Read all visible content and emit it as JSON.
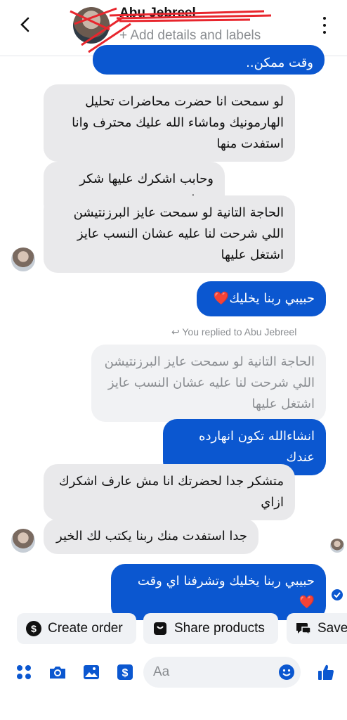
{
  "header": {
    "name": "Abu Jebreel",
    "subtitle": "+ Add details and labels"
  },
  "chat": {
    "top_partial": "وقت ممكن..",
    "messages": [
      {
        "who": "in",
        "text": "لو سمحت انا حضرت محاضرات تحليل الهارمونيك وماشاء الله عليك محترف وانا استفدت منها"
      },
      {
        "who": "in",
        "text": "وحابب اشكرك عليها شكر جزيل"
      },
      {
        "who": "in",
        "text": "الحاجة التانية لو سمحت عايز البرزنتيشن اللي شرحت لنا عليه عشان النسب عايز اشتغل عليها"
      },
      {
        "who": "out",
        "text": "حبيبي ربنا يخليك❤️"
      },
      {
        "who": "meta",
        "text": "You replied to Abu Jebreel"
      },
      {
        "who": "quoted",
        "text": "الحاجة التانية لو سمحت عايز البرزنتيشن اللي شرحت لنا عليه عشان النسب عايز اشتغل عليها"
      },
      {
        "who": "out",
        "text": "انشاءالله تكون انهارده عندك"
      },
      {
        "who": "in",
        "text": "متشكر جدا لحضرتك انا مش عارف اشكرك ازاي"
      },
      {
        "who": "in",
        "text": "جدا استفدت منك ربنا يكتب لك الخير"
      },
      {
        "who": "out",
        "text": "حبيبي ربنا يخليك وتشرفنا اي وقت❤️"
      }
    ]
  },
  "actions": {
    "create_order": "Create order",
    "share_products": "Share products",
    "save": "Save"
  },
  "composer": {
    "placeholder": "Aa"
  },
  "colors": {
    "accent": "#0b57d0",
    "incoming": "#e9e9eb"
  }
}
